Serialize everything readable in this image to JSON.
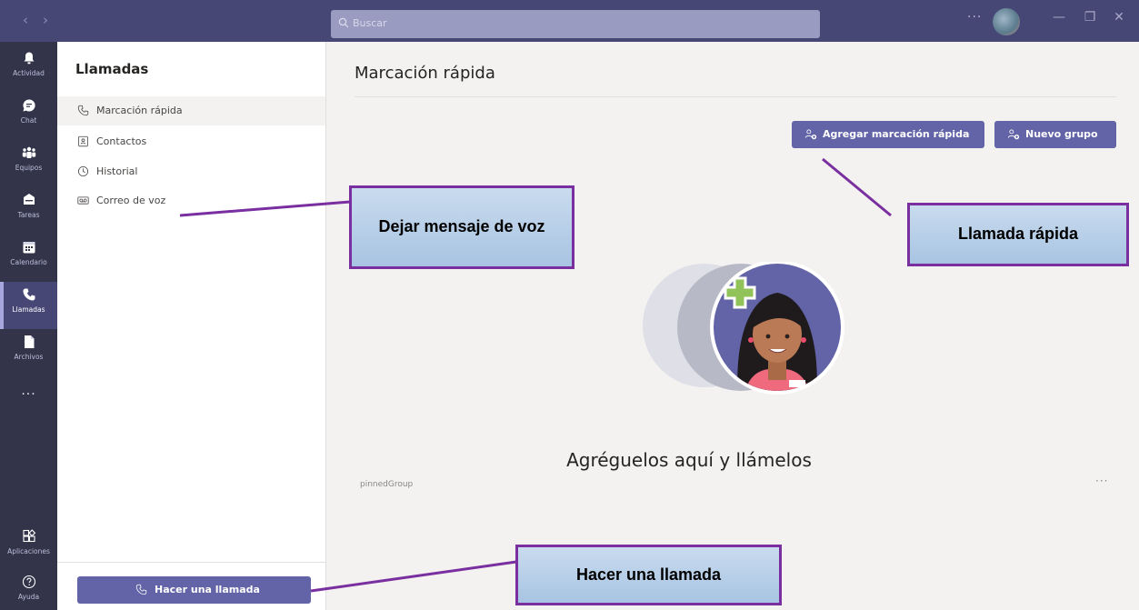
{
  "titlebar": {
    "back_icon": "chevron-left-icon",
    "forward_icon": "chevron-right-icon",
    "search_placeholder": "Buscar",
    "more_label": "···",
    "minimize_label": "—",
    "maximize_label": "❐",
    "close_label": "✕"
  },
  "rail": {
    "items": [
      {
        "label": "Actividad",
        "icon": "bell-icon"
      },
      {
        "label": "Chat",
        "icon": "chat-icon"
      },
      {
        "label": "Equipos",
        "icon": "teams-icon"
      },
      {
        "label": "Tareas",
        "icon": "tasks-icon"
      },
      {
        "label": "Calendario",
        "icon": "calendar-icon"
      },
      {
        "label": "Llamadas",
        "icon": "phone-icon"
      },
      {
        "label": "Archivos",
        "icon": "file-icon"
      }
    ],
    "more_label": "···",
    "apps_label": "Aplicaciones",
    "help_label": "Ayuda"
  },
  "panel": {
    "title": "Llamadas",
    "items": [
      {
        "label": "Marcación rápida",
        "icon": "phone-icon"
      },
      {
        "label": "Contactos",
        "icon": "contacts-icon"
      },
      {
        "label": "Historial",
        "icon": "clock-icon"
      },
      {
        "label": "Correo de voz",
        "icon": "voicemail-icon"
      }
    ],
    "call_button": "Hacer una llamada"
  },
  "main": {
    "title": "Marcación rápida",
    "add_speed_dial": "Agregar marcación rápida",
    "new_group": "Nuevo grupo",
    "empty_text": "Agréguelos aquí y llámelos",
    "group_label": "pinnedGroup",
    "group_more": "···"
  },
  "callouts": {
    "voicemail": "Dejar mensaje de voz",
    "speed_dial": "Llamada rápida",
    "make_call": "Hacer una llamada"
  },
  "colors": {
    "titlebar": "#464775",
    "rail": "#33344a",
    "accent": "#6264a7",
    "callout_border": "#7a2fa0",
    "callout_fill": "#b4cde8"
  }
}
